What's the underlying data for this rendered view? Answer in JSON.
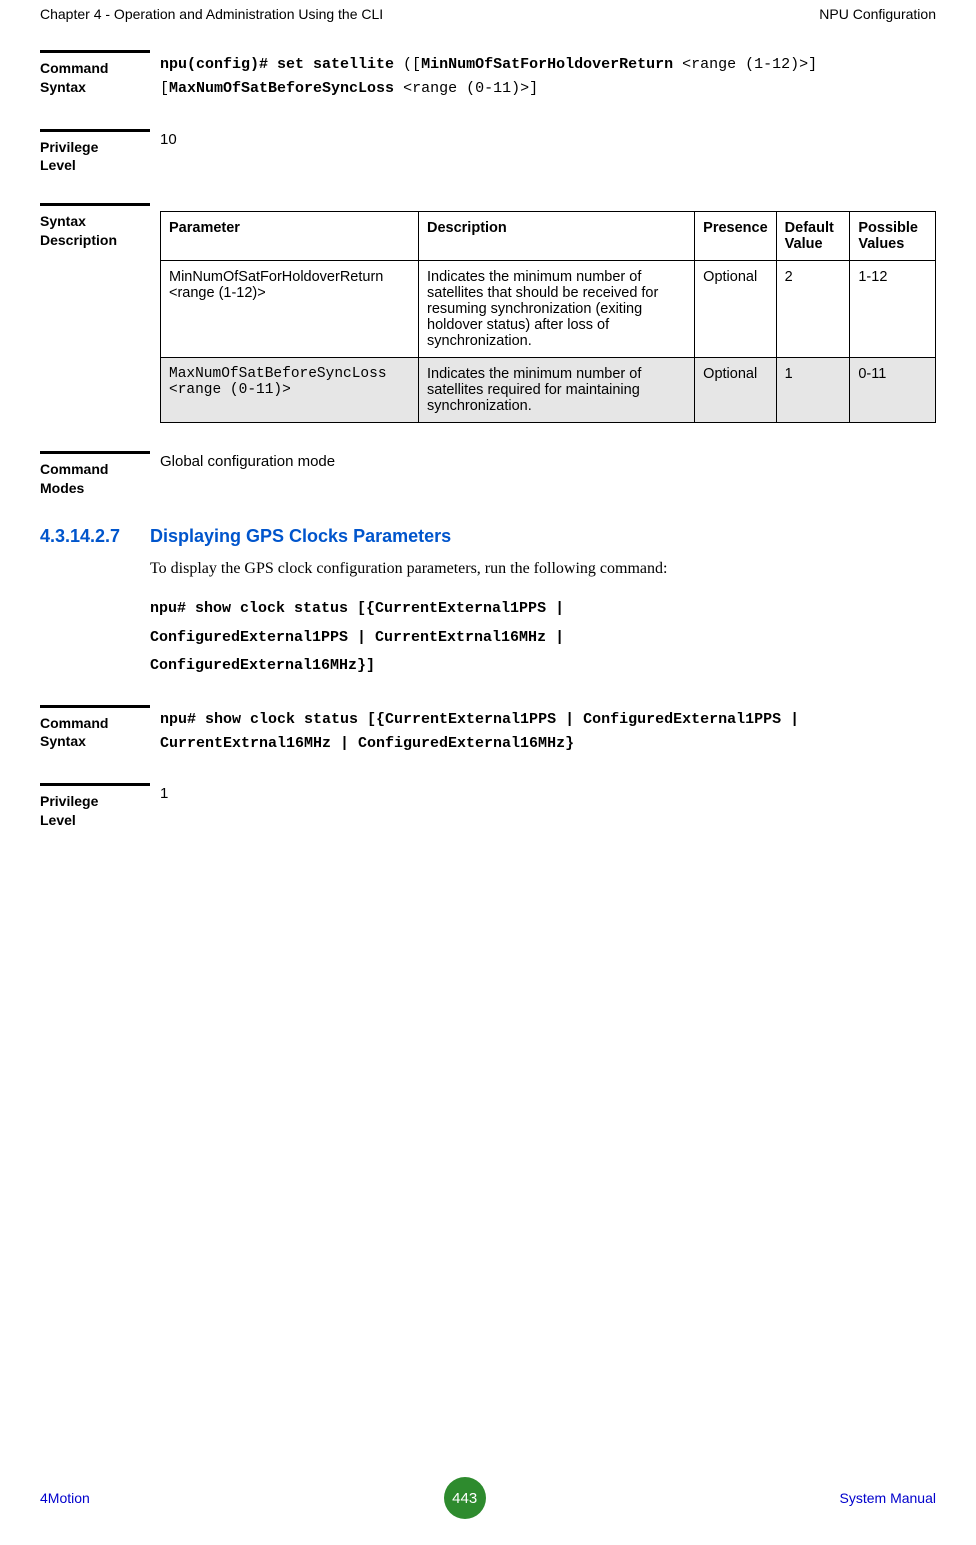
{
  "header": {
    "left": "Chapter 4 - Operation and Administration Using the CLI",
    "right": "NPU Configuration"
  },
  "specs": [
    {
      "label": "Command\nSyntax",
      "type": "cmdsyntax1",
      "segments": [
        {
          "text": "npu(config)# set satellite ",
          "cls": "mono bold"
        },
        {
          "text": "([",
          "cls": "mono"
        },
        {
          "text": "MinNumOfSatForHoldoverReturn ",
          "cls": "mono bold"
        },
        {
          "text": "<range (1-12)>] ",
          "cls": "mono"
        },
        {
          "text": "\n[",
          "cls": "mono"
        },
        {
          "text": "MaxNumOfSatBeforeSyncLoss ",
          "cls": "mono bold"
        },
        {
          "text": "<range (0-11)>]",
          "cls": "mono"
        }
      ]
    },
    {
      "label": "Privilege\nLevel",
      "type": "plain",
      "value": "10"
    },
    {
      "label": "Syntax\nDescription",
      "type": "param_table",
      "headers": [
        "Parameter",
        "Description",
        "Presence",
        "Default Value",
        "Possible Values"
      ],
      "rows": [
        {
          "shaded": false,
          "cells": [
            "MinNumOfSatForHoldoverReturn <range (1-12)>",
            "Indicates the minimum number of satellites that should be received for resuming synchronization (exiting holdover status) after loss of synchronization.",
            "Optional",
            "2",
            "1-12"
          ]
        },
        {
          "shaded": true,
          "cells_mono_first": true,
          "cells": [
            "MaxNumOfSatBeforeSyncLoss <range (0-11)>",
            "Indicates the minimum number of satellites required for maintaining synchronization.",
            "Optional",
            "1",
            "0-11"
          ]
        }
      ]
    },
    {
      "label": "Command\nModes",
      "type": "plain",
      "value": "Global configuration mode"
    }
  ],
  "section": {
    "number": "4.3.14.2.7",
    "title": "Displaying GPS Clocks Parameters",
    "body": "To display the GPS clock configuration parameters, run the following command:",
    "code_lines": [
      "npu# show clock status [{CurrentExternal1PPS |",
      "ConfiguredExternal1PPS | CurrentExtrnal16MHz |",
      "ConfiguredExternal16MHz}]"
    ]
  },
  "specs2": [
    {
      "label": "Command\nSyntax",
      "type": "cmdsyntax2",
      "segments": [
        {
          "text": "npu# show ",
          "cls": "mono bold"
        },
        {
          "text": "clock status [{CurrentExternal1PPS | ConfiguredExternal1PPS | CurrentExtrnal16MHz | ConfiguredExternal16MHz}",
          "cls": "mono bold"
        }
      ]
    },
    {
      "label": "Privilege\nLevel",
      "type": "plain",
      "value": "1"
    }
  ],
  "footer": {
    "left": "4Motion",
    "page": "443",
    "right": "System Manual"
  }
}
